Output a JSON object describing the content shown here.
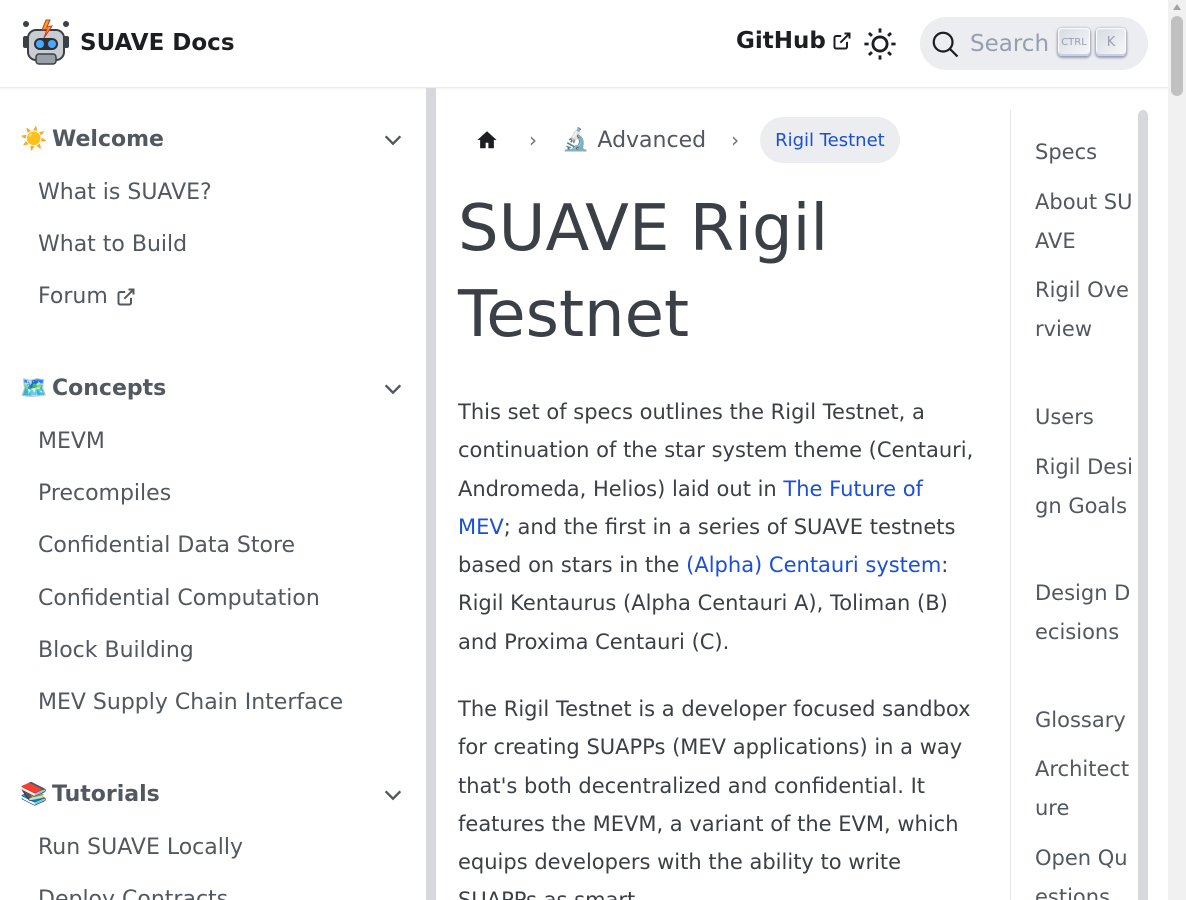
{
  "navbar": {
    "brand_title": "SUAVE Docs",
    "github_label": "GitHub",
    "theme_icon": "sun-icon",
    "search_placeholder": "Search",
    "search_kbd_ctrl": "CTRL",
    "search_kbd_key": "K"
  },
  "sidebar": {
    "categories": [
      {
        "emoji": "☀️",
        "label": "Welcome",
        "items": [
          {
            "label": "What is SUAVE?"
          },
          {
            "label": "What to Build"
          },
          {
            "label": "Forum"
          }
        ]
      },
      {
        "emoji": "🗺️",
        "label": "Concepts",
        "items": [
          {
            "label": "MEVM"
          },
          {
            "label": "Precompiles"
          },
          {
            "label": "Confidential Data Store"
          },
          {
            "label": "Confidential Computation"
          },
          {
            "label": "Block Building"
          },
          {
            "label": "MEV Supply Chain Interface"
          }
        ]
      },
      {
        "emoji": "📚",
        "label": "Tutorials",
        "items": [
          {
            "label": "Run SUAVE Locally"
          },
          {
            "label": "Deploy Contracts"
          }
        ]
      }
    ]
  },
  "breadcrumb": {
    "advanced_emoji": "🔬",
    "advanced_label": "Advanced",
    "current_label": "Rigil Testnet"
  },
  "article": {
    "title": "SUAVE Rigil Testnet",
    "p1": {
      "t1": "This set of specs outlines the Rigil Testnet, a continuation of the star system theme (Centauri, Andromeda, Helios) laid out in ",
      "link1": "The Future of MEV",
      "t2": "; and the first in a series of SUAVE testnets based on stars in the ",
      "link2": "(Alpha) Centauri system",
      "t3": ": Rigil Kentaurus (Alpha Centauri A), Toliman (B) and Proxima Centauri (C)."
    },
    "p2": "The Rigil Testnet is a developer focused sandbox for creating SUAPPs (MEV applications) in a way that's both decentralized and confidential. It features the MEVM, a variant of the EVM, which equips developers with the ability to write SUAPPs as smart"
  },
  "toc": {
    "items": [
      {
        "label": "Specs"
      },
      {
        "label": "About SUAVE"
      },
      {
        "label": "Rigil Overview"
      },
      {
        "label": "Users"
      },
      {
        "label": "Rigil Design Goals"
      },
      {
        "label": "Design Decisions"
      },
      {
        "label": "Glossary"
      },
      {
        "label": "Architecture"
      },
      {
        "label": "Open Questions"
      }
    ]
  },
  "colors": {
    "link": "#1a4fd6",
    "text": "#3b4047",
    "sidebar_text": "#525860",
    "pill_bg": "#ebedf0"
  }
}
